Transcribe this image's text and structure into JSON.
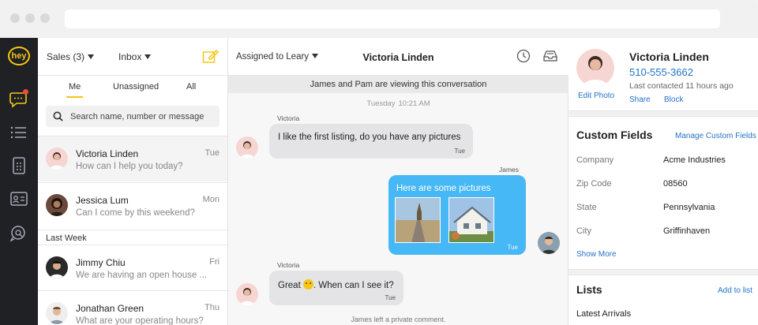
{
  "sidebar": {
    "logo_text": "hey",
    "accent": "#f5c518",
    "icons": [
      "chat-icon",
      "list-icon",
      "document-icon",
      "contact-card-icon",
      "search-chat-icon"
    ]
  },
  "list": {
    "team_dropdown": "Sales (3)",
    "folder_dropdown": "Inbox",
    "filters": [
      "Me",
      "Unassigned",
      "All"
    ],
    "search_placeholder": "Search name, number or message",
    "conversations": [
      {
        "name": "Victoria Linden",
        "preview": "How can I help you today?",
        "time": "Tue"
      },
      {
        "name": "Jessica Lum",
        "preview": "Can I come by this weekend?",
        "time": "Mon"
      },
      {
        "name": "Jimmy Chiu",
        "preview": "We are having an open house ...",
        "time": "Fri"
      },
      {
        "name": "Jonathan Green",
        "preview": "What are your operating hours?",
        "time": "Thu"
      }
    ],
    "section_last_week": "Last Week"
  },
  "chat": {
    "assigned": "Assigned to Leary",
    "title": "Victoria Linden",
    "viewing_notice": "James and Pam are viewing this conversation",
    "day": "Tuesday",
    "day_time": "10:21 AM",
    "messages": [
      {
        "sender": "Victoria",
        "text": "I like the first listing, do you have any pictures",
        "time": "Tue"
      },
      {
        "sender": "James",
        "text": "Here are some pictures",
        "time": "Tue"
      },
      {
        "sender": "Victoria",
        "text_before": "Great",
        "text_after": ". When can I see it?",
        "time": "Tue"
      }
    ],
    "private_notice": "James left a private comment.",
    "out_color": "#46b8f5"
  },
  "contact": {
    "name": "Victoria Linden",
    "phone": "510-555-3662",
    "last_contacted": "Last contacted 11 hours ago",
    "edit_photo": "Edit Photo",
    "share": "Share",
    "block": "Block",
    "custom_fields_title": "Custom Fields",
    "manage_link": "Manage Custom Fields",
    "fields": [
      {
        "label": "Company",
        "value": "Acme Industries"
      },
      {
        "label": "Zip Code",
        "value": "08560"
      },
      {
        "label": "State",
        "value": "Pennsylvania"
      },
      {
        "label": "City",
        "value": "Griffinhaven"
      }
    ],
    "show_more": "Show More",
    "lists_title": "Lists",
    "add_to_list": "Add to list",
    "lists": [
      "Latest Arrivals"
    ],
    "link_color": "#2474c9"
  }
}
